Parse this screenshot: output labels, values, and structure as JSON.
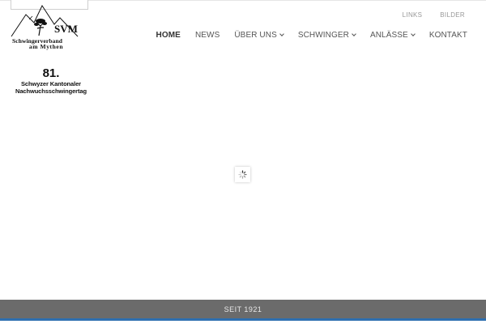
{
  "logo": {
    "initials": "SVM",
    "line1": "Schwingerverband",
    "line2": "am  Mythen"
  },
  "event": {
    "number": "81.",
    "line1": "Schwyzer Kantonaler",
    "line2": "Nachwuchsschwingertag"
  },
  "top_links": [
    "LINKS",
    "BILDER"
  ],
  "nav": {
    "items": [
      {
        "label": "HOME",
        "active": true
      },
      {
        "label": "NEWS"
      },
      {
        "label": "ÜBER UNS",
        "dropdown": true
      },
      {
        "label": "SCHWINGER",
        "dropdown": true
      },
      {
        "label": "ANLÄSSE",
        "dropdown": true
      },
      {
        "label": "KONTAKT"
      }
    ]
  },
  "footer": {
    "text": "SEIT 1921"
  },
  "colors": {
    "footer_bg": "#6b6b6b",
    "accent": "#2e6fb0",
    "nav_text": "#555555"
  },
  "icons": {
    "loader": "spinner-icon",
    "dropdown": "chevron-down-icon"
  }
}
